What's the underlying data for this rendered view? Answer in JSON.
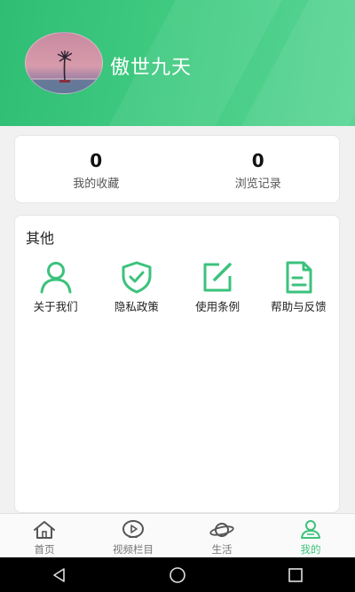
{
  "profile": {
    "username": "傲世九天"
  },
  "stats": [
    {
      "value": "0",
      "label": "我的收藏"
    },
    {
      "value": "0",
      "label": "浏览记录"
    }
  ],
  "other": {
    "title": "其他",
    "items": [
      {
        "label": "关于我们",
        "icon": "user-icon"
      },
      {
        "label": "隐私政策",
        "icon": "shield-check-icon"
      },
      {
        "label": "使用条例",
        "icon": "edit-icon"
      },
      {
        "label": "帮助与反馈",
        "icon": "document-icon"
      }
    ]
  },
  "tabbar": {
    "tabs": [
      {
        "label": "首页",
        "icon": "home-icon"
      },
      {
        "label": "视频栏目",
        "icon": "play-icon"
      },
      {
        "label": "生活",
        "icon": "planet-icon"
      },
      {
        "label": "我的",
        "icon": "profile-icon",
        "active": true
      }
    ]
  },
  "system_nav": [
    "back-icon",
    "home-circle-icon",
    "recents-icon"
  ],
  "colors": {
    "accent": "#3cc27c",
    "header_start": "#2fbd74",
    "header_end": "#5bd595"
  }
}
